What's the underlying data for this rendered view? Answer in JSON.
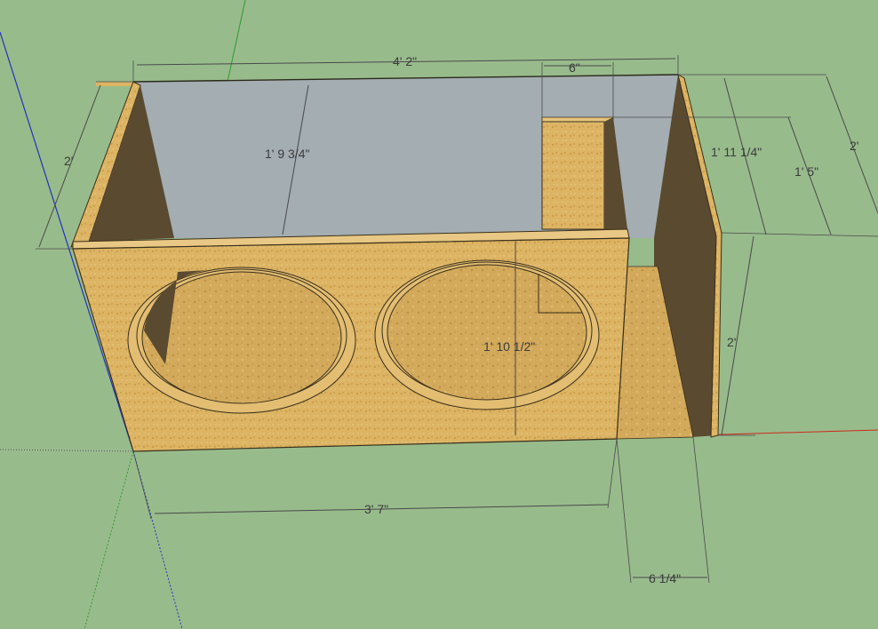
{
  "scene": {
    "type": "3d-model-viewport",
    "subject": "dual subwoofer ported box",
    "colors": {
      "ground": "#98bb8c",
      "mdf": "#dcb463",
      "mdf_dark": "#c99c4b",
      "inner_shadow": "#5a4a30",
      "back_panel": "#a3adb2",
      "axis_red": "#cc2a1a",
      "axis_green": "#2f9a2f",
      "axis_blue": "#2233bb"
    }
  },
  "dimensions": {
    "overall_width": "4' 2\"",
    "port_width": "6\"",
    "left_height": "2'",
    "inner_height": "1' 9 3/4\"",
    "depth_right": "1' 11 1/4\"",
    "port_height": "1' 5\"",
    "right_outer": "2'",
    "cutout_diameter": "1' 10 1/2\"",
    "front_height": "2'",
    "front_width": "3' 7\"",
    "port_opening": "6 1/4\""
  }
}
